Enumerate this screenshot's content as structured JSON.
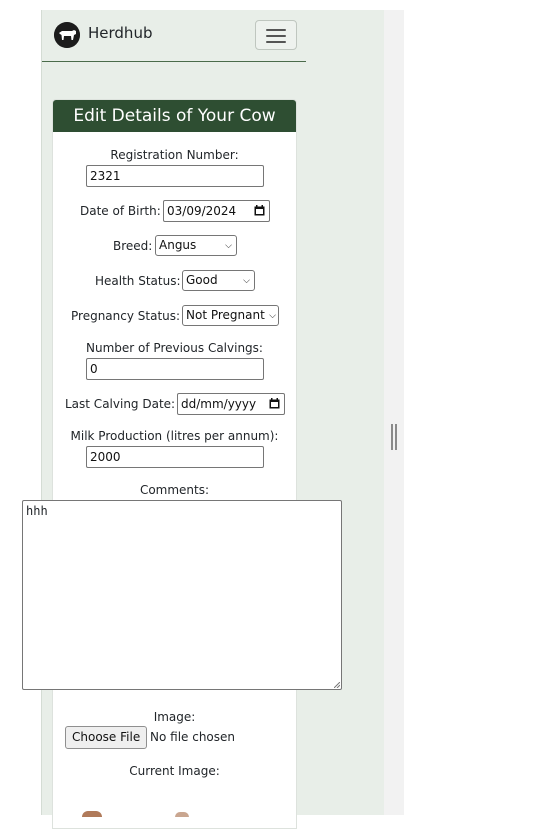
{
  "navbar": {
    "brand": "Herdhub",
    "logo_icon": "cow-icon",
    "menu_icon": "hamburger-icon"
  },
  "form": {
    "title": "Edit Details of Your Cow",
    "registration_label": "Registration Number:",
    "registration_value": "2321",
    "dob_label": "Date of Birth:",
    "dob_value": "03/09/2024",
    "breed_label": "Breed:",
    "breed_value": "Angus",
    "health_label": "Health Status:",
    "health_value": "Good",
    "pregnancy_label": "Pregnancy Status:",
    "pregnancy_value": "Not Pregnant",
    "calvings_label": "Number of Previous Calvings:",
    "calvings_value": "0",
    "last_calving_label": "Last Calving Date:",
    "last_calving_placeholder": "dd/mm/yyyy",
    "milk_label": "Milk Production (litres per annum):",
    "milk_value": "2000",
    "comments_label": "Comments:",
    "comments_value": "hhh",
    "image_label": "Image:",
    "choose_file_label": "Choose File",
    "no_file_text": "No file chosen",
    "current_image_label": "Current Image:"
  },
  "colors": {
    "header_bg": "#2e4e32",
    "page_bg": "#e8eee8"
  }
}
